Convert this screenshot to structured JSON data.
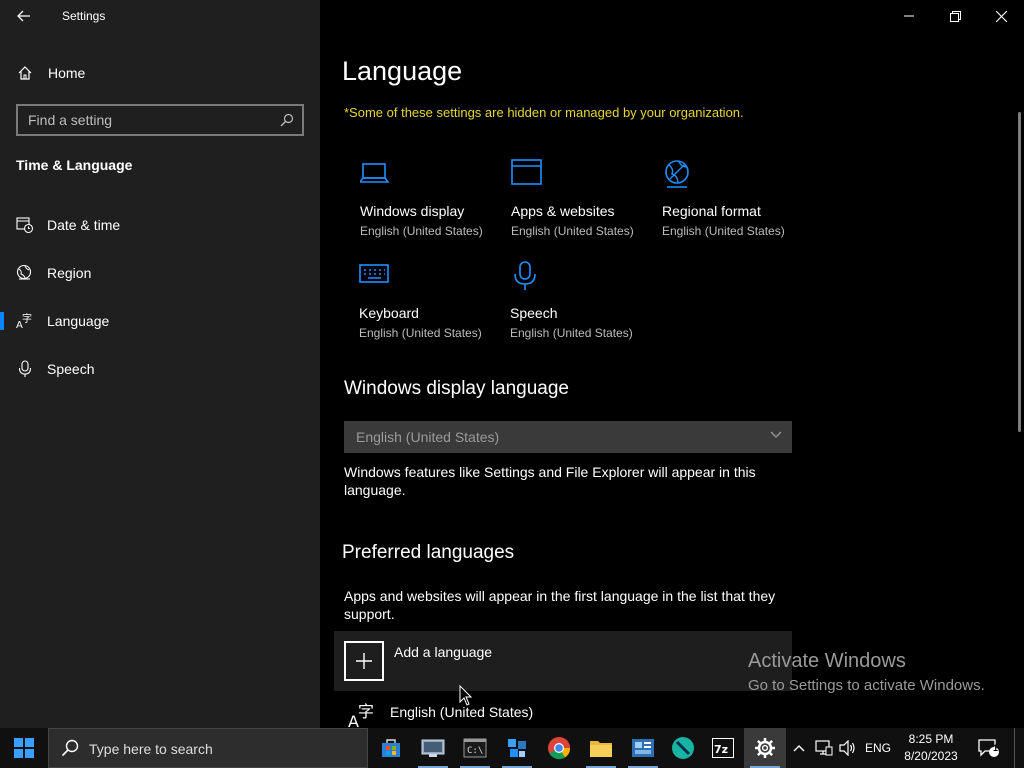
{
  "app": {
    "title": "Settings"
  },
  "nav": {
    "home_label": "Home",
    "search_placeholder": "Find a setting",
    "section_title": "Time & Language",
    "items": [
      {
        "label": "Date & time",
        "icon": "clock-calendar-icon",
        "selected": false
      },
      {
        "label": "Region",
        "icon": "globe-region-icon",
        "selected": false
      },
      {
        "label": "Language",
        "icon": "language-icon",
        "selected": true
      },
      {
        "label": "Speech",
        "icon": "microphone-icon",
        "selected": false
      }
    ]
  },
  "main": {
    "title": "Language",
    "org_notice": "*Some of these settings are hidden or managed by your organization.",
    "tiles": [
      {
        "name": "Windows display",
        "sub": "English (United States)",
        "icon": "laptop-icon"
      },
      {
        "name": "Apps & websites",
        "sub": "English (United States)",
        "icon": "browser-window-icon"
      },
      {
        "name": "Regional format",
        "sub": "English (United States)",
        "icon": "globe-icon"
      },
      {
        "name": "Keyboard",
        "sub": "English (United States)",
        "icon": "keyboard-icon"
      },
      {
        "name": "Speech",
        "sub": "English (United States)",
        "icon": "microphone-icon"
      }
    ],
    "display_language": {
      "heading": "Windows display language",
      "selected": "English (United States)",
      "description": "Windows features like Settings and File Explorer will appear in this language."
    },
    "preferred": {
      "heading": "Preferred languages",
      "description": "Apps and websites will appear in the first language in the list that they support.",
      "add_label": "Add a language",
      "languages": [
        "English (United States)"
      ]
    },
    "watermark": {
      "line1": "Activate Windows",
      "line2": "Go to Settings to activate Windows."
    }
  },
  "taskbar": {
    "search_placeholder": "Type here to search",
    "language": "ENG",
    "time": "8:25 PM",
    "date": "8/20/2023",
    "notifications": "1"
  },
  "colors": {
    "accent": "#0a84ff",
    "org_notice": "#e6d43a",
    "nav_bg": "#1f1f1f",
    "main_bg": "#000000"
  }
}
